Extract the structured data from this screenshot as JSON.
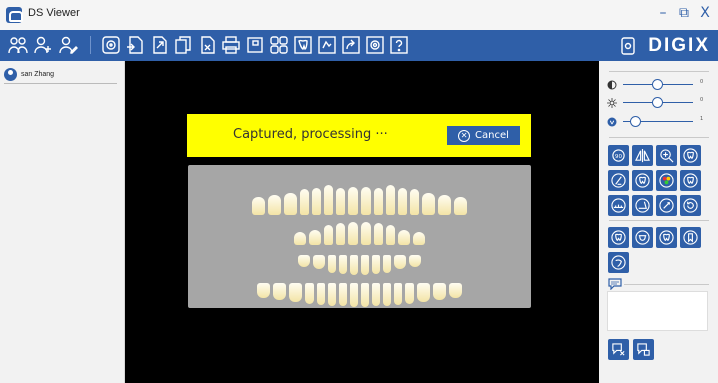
{
  "window": {
    "title": "DS Viewer"
  },
  "window_controls": {
    "minimize": "–",
    "restore": "⧉",
    "close": "X"
  },
  "brand": {
    "logo_text": "DIGIX"
  },
  "patient": {
    "name": "san Zhang"
  },
  "capture": {
    "status_text": "Captured, processing ···",
    "cancel_label": "Cancel"
  },
  "adjustments": {
    "contrast": {
      "value": "0"
    },
    "brightness": {
      "value": "0"
    },
    "gamma": {
      "value": "1"
    }
  },
  "colors": {
    "accent": "#2f5fa8",
    "banner": "#ffff00",
    "viewer_bg": "#000000",
    "chart_bg": "#a6a6a6"
  },
  "toolbar_icons": [
    "patients-icon",
    "add-patient-icon",
    "edit-patient-icon",
    "sensor-icon",
    "import-image-icon",
    "export-image-icon",
    "copy-image-icon",
    "delete-image-icon",
    "print-icon",
    "single-view-icon",
    "multi-view-icon",
    "tooth-chart-icon",
    "report-icon",
    "share-icon",
    "settings-icon",
    "help-icon"
  ],
  "image_tools": [
    "rotate-90-icon",
    "flip-icon",
    "zoom-icon",
    "tooth-outline-icon",
    "sharpen-icon",
    "tooth-enhance-icon",
    "color-map-icon",
    "tooth-filter-icon",
    "measure-icon",
    "angle-icon",
    "calibrate-icon",
    "reset-icon",
    "tooth-a-icon",
    "tooth-b-icon",
    "tooth-c-icon",
    "tooth-d-icon",
    "tooth-e-icon"
  ],
  "note_tools": [
    "note-add-icon",
    "note-save-icon"
  ]
}
